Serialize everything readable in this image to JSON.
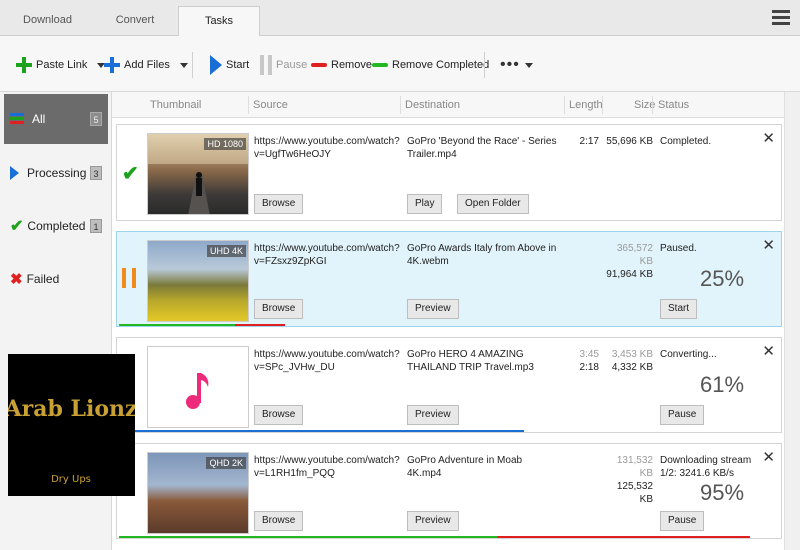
{
  "tabs": [
    "Download",
    "Convert",
    "Tasks"
  ],
  "toolbar": {
    "paste_link": "Paste Link",
    "add_files": "Add Files",
    "start": "Start",
    "pause": "Pause",
    "remove": "Remove",
    "remove_completed": "Remove Completed",
    "more": "•••"
  },
  "sidebar": [
    {
      "label": "All",
      "count": "5"
    },
    {
      "label": "Processing",
      "count": "3"
    },
    {
      "label": "Completed",
      "count": "1"
    },
    {
      "label": "Failed",
      "count": ""
    }
  ],
  "columns": [
    "Thumbnail",
    "Source",
    "Destination",
    "Length",
    "Size",
    "Status"
  ],
  "tasks": [
    {
      "badge": "HD 1080",
      "source": "https://www.youtube.com/watch?v=UgfTw6HeOJY",
      "destination": "GoPro  'Beyond the Race' - Series Trailer.mp4",
      "length_top": "2:17",
      "length_bottom": "",
      "size_top": "55,696 KB",
      "size_bottom": "",
      "status": "Completed.",
      "percent": "",
      "buttons": [
        "Browse",
        "Play",
        "Open Folder",
        ""
      ]
    },
    {
      "badge": "UHD 4K",
      "source": "https://www.youtube.com/watch?v=FZsxz9ZpKGI",
      "destination": "GoPro Awards  Italy from Above in 4K.webm",
      "length_top": "",
      "length_bottom": "",
      "size_top": "365,572 KB",
      "size_bottom": "91,964 KB",
      "status": "Paused.",
      "percent": "25%",
      "buttons": [
        "Browse",
        "Preview",
        "",
        "Start"
      ],
      "progress": 0.25
    },
    {
      "badge": "",
      "source": "https://www.youtube.com/watch?v=SPc_JVHw_DU",
      "destination": "GoPro HERO 4  AMAZING THAILAND TRIP  Travel.mp3",
      "length_top": "3:45",
      "length_bottom": "2:18",
      "size_top": "3,453 KB",
      "size_bottom": "4,332 KB",
      "status": "Converting...",
      "percent": "61%",
      "buttons": [
        "Browse",
        "Preview",
        "",
        "Pause"
      ],
      "progress": 0.61
    },
    {
      "badge": "QHD 2K",
      "source": "https://www.youtube.com/watch?v=L1RH1fm_PQQ",
      "destination": "GoPro  Adventure in Moab 4K.mp4",
      "length_top": "",
      "length_bottom": "",
      "size_top": "131,532 KB",
      "size_bottom": "125,532 KB",
      "status": "Downloading stream 1/2: 3241.6 KB/s",
      "percent": "95%",
      "buttons": [
        "Browse",
        "Preview",
        "",
        "Pause"
      ],
      "progress": 0.95
    }
  ],
  "watermark": {
    "line1": "Arab Lionz",
    "line2": "Dry Ups"
  },
  "colors": {
    "accent": "#1a6fd6",
    "green": "#1da21d",
    "red": "#e02020",
    "orange": "#f08a1c",
    "selected_row": "#e2f4fb"
  }
}
